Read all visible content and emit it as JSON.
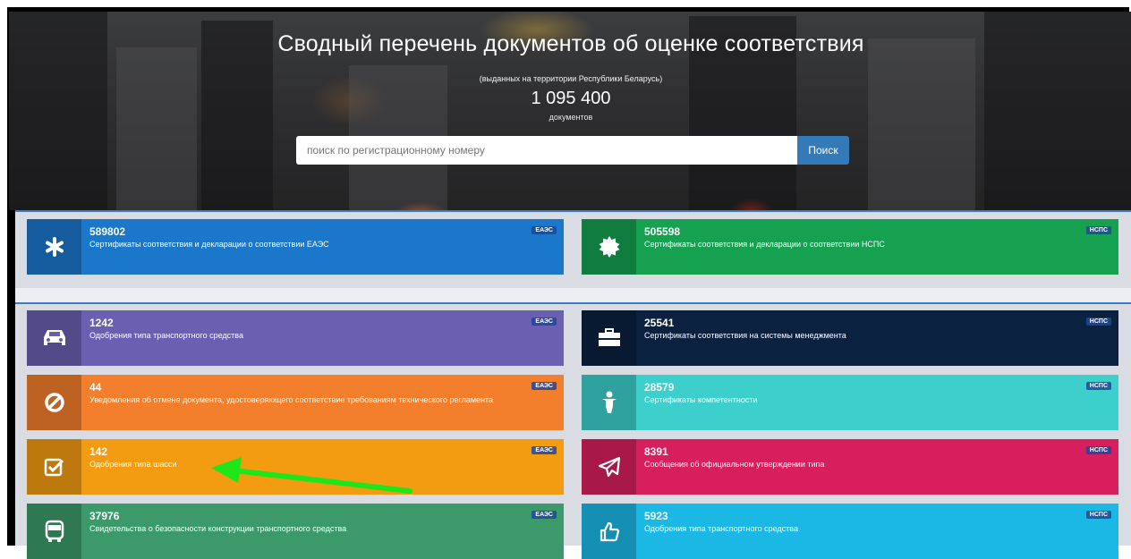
{
  "hero": {
    "title": "Сводный перечень документов об оценке соответствия",
    "subtitle": "(выданных на территории Республики Беларусь)",
    "count": "1 095 400",
    "count_unit": "документов"
  },
  "search": {
    "placeholder": "поиск по регистрационному номеру",
    "button_label": "Поиск"
  },
  "colors": {
    "accent": "#337ab7",
    "eaes_blue": "#1a77c9",
    "nsps_green": "#15a150"
  },
  "cards": [
    {
      "number": "589802",
      "label": "Сертификаты соответствия и декларации о соответствии ЕАЭС",
      "badge": "ЕАЭС",
      "icon": "asterisk-icon",
      "color": "#1a77c9"
    },
    {
      "number": "505598",
      "label": "Сертификаты соответствия и декларации о соответствии НСПС",
      "badge": "НСПС",
      "icon": "gear-badge-icon",
      "color": "#15a150"
    },
    {
      "number": "1242",
      "label": "Одобрения типа транспортного средства",
      "badge": "ЕАЭС",
      "icon": "car-icon",
      "color": "#6a5fb0"
    },
    {
      "number": "25541",
      "label": "Сертификаты соответствия на системы менеджмента",
      "badge": "НСПС",
      "icon": "briefcase-icon",
      "color": "#0b2140"
    },
    {
      "number": "44",
      "label": "Уведомления об отмене документа, удостоверяющего соответствие требованиям технического регламента",
      "badge": "ЕАЭС",
      "icon": "ban-icon",
      "color": "#f37e2b"
    },
    {
      "number": "28579",
      "label": "Сертификаты компетентности",
      "badge": "НСПС",
      "icon": "person-icon",
      "color": "#3dcfcb"
    },
    {
      "number": "142",
      "label": "Одобрения типа шасси",
      "badge": "ЕАЭС",
      "icon": "checkbox-icon",
      "color": "#f39c12"
    },
    {
      "number": "8391",
      "label": "Сообщения об официальном утверждении типа",
      "badge": "НСПС",
      "icon": "paper-plane-icon",
      "color": "#d81f5e"
    },
    {
      "number": "37976",
      "label": "Свидетельства о безопасности конструкции транспортного средства",
      "badge": "ЕАЭС",
      "icon": "bus-icon",
      "color": "#3c9a6a"
    },
    {
      "number": "5923",
      "label": "Одобрения типа транспортного средства",
      "badge": "НСПС",
      "icon": "thumbs-up-icon",
      "color": "#1bb8e6"
    }
  ]
}
